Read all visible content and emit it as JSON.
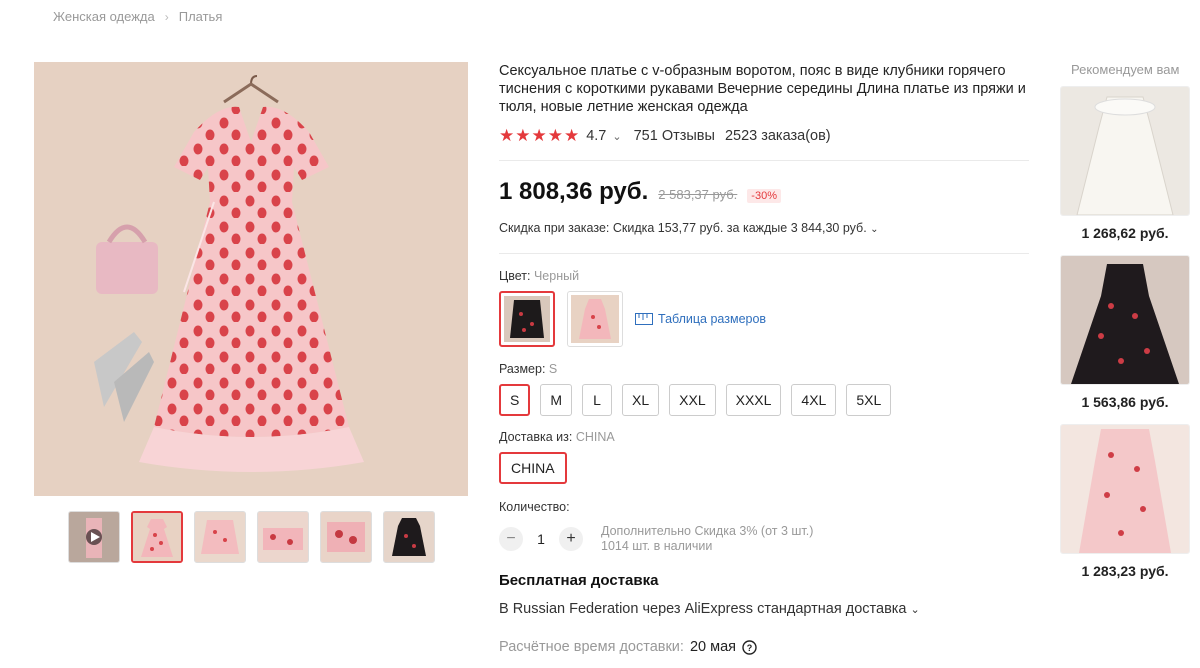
{
  "breadcrumb": {
    "items": [
      "Женская одежда",
      "Платья"
    ]
  },
  "product": {
    "title": "Сексуальное платье с v-образным воротом, пояс в виде клубники горячего тиснения с короткими рукавами Вечерние середины Длина платье из пряжи и тюля, новые летние женская одежда",
    "stars": "★★★★★",
    "rating": "4.7",
    "reviews": "751 Отзывы",
    "orders": "2523 заказа(ов)",
    "price": "1 808,36 руб.",
    "old_price": "2 583,37 руб.",
    "discount": "-30%",
    "promo": "Скидка при заказе: Скидка 153,77 руб. за каждые 3 844,30 руб.",
    "color_label": "Цвет:",
    "color_value": "Черный",
    "size_table": "Таблица размеров",
    "size_label": "Размер:",
    "size_value": "S",
    "sizes": [
      "S",
      "M",
      "L",
      "XL",
      "XXL",
      "XXXL",
      "4XL",
      "5XL"
    ],
    "ship_from_label": "Доставка из:",
    "ship_from_value": "CHINA",
    "ship_from_option": "CHINA",
    "qty_label": "Количество:",
    "qty_value": "1",
    "qty_discount": "Дополнительно Скидка 3% (от 3 шт.)",
    "stock": "1014 шт. в наличии",
    "free_shipping": "Бесплатная доставка",
    "ship_via": "В Russian Federation через AliExpress стандартная доставка",
    "delivery_label": "Расчётное время доставки:",
    "delivery_date": "20 мая"
  },
  "recommend": {
    "title": "Рекомендуем вам",
    "items": [
      {
        "price": "1 268,62 руб."
      },
      {
        "price": "1 563,86 руб."
      },
      {
        "price": "1 283,23 руб."
      }
    ]
  },
  "colors": {
    "accent": "#e4393c",
    "link": "#2f6fbd"
  }
}
